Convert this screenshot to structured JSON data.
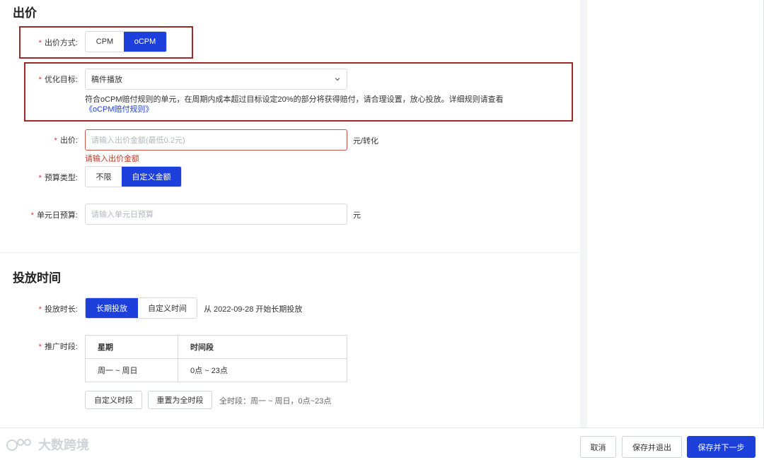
{
  "bid_section": {
    "title": "出价",
    "bid_method": {
      "label": "出价方式:",
      "options": [
        "CPM",
        "oCPM"
      ],
      "selected": "oCPM"
    },
    "optimization_goal": {
      "label": "优化目标:",
      "value": "稿件播放",
      "hint": "符合oCPM赔付规则的单元，在周期内成本超过目标设定20%的部分将获得赔付，请合理设置，放心投放。详细规则请查看",
      "hint_link": "《oCPM赔付规则》"
    },
    "bid": {
      "label": "出价:",
      "placeholder": "请输入出价金额(最低0.2元)",
      "unit": "元/转化",
      "error": "请输入出价金额"
    },
    "budget_type": {
      "label": "预算类型:",
      "options": [
        "不限",
        "自定义金额"
      ],
      "selected": "自定义金额"
    },
    "daily_budget": {
      "label": "单元日预算:",
      "placeholder": "请输入单元日预算",
      "unit": "元"
    }
  },
  "schedule_section": {
    "title": "投放时间",
    "duration": {
      "label": "投放时长:",
      "options": [
        "长期投放",
        "自定义时间"
      ],
      "selected": "长期投放",
      "note": "从 2022-09-28 开始长期投放"
    },
    "time_slot": {
      "label": "推广时段:",
      "table": {
        "headers": [
          "星期",
          "时间段"
        ],
        "rows": [
          [
            "周一 ~ 周日",
            "0点 ~ 23点"
          ]
        ]
      },
      "custom_button": "自定义时段",
      "reset_button": "重置为全时段",
      "summary": "全时段：周一 ~ 周日，0点~23点"
    }
  },
  "footer": {
    "cancel": "取消",
    "save_exit": "保存并退出",
    "save_next": "保存并下一步"
  },
  "watermark": "大数跨境",
  "colors": {
    "primary": "#1d3fdc",
    "error": "#c0392b",
    "required_star": "#e0362b",
    "highlight_box": "#9b2a2a"
  }
}
